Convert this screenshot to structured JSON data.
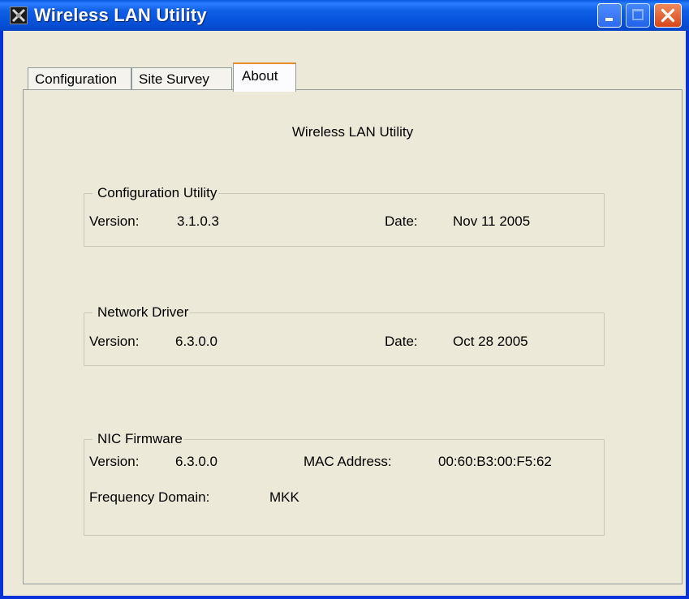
{
  "window": {
    "title": "Wireless LAN Utility",
    "controls": {
      "minimize": "minimize",
      "maximize": "maximize",
      "close": "close"
    }
  },
  "tabs": [
    {
      "label": "Configuration",
      "selected": false
    },
    {
      "label": "Site Survey",
      "selected": false
    },
    {
      "label": "About",
      "selected": true
    }
  ],
  "about": {
    "heading": "Wireless LAN Utility",
    "config_utility": {
      "group_label": "Configuration Utility",
      "version_label": "Version:",
      "version": "3.1.0.3",
      "date_label": "Date:",
      "date": "Nov 11 2005"
    },
    "network_driver": {
      "group_label": "Network Driver",
      "version_label": "Version:",
      "version": "6.3.0.0",
      "date_label": "Date:",
      "date": "Oct 28 2005"
    },
    "nic_firmware": {
      "group_label": "NIC Firmware",
      "version_label": "Version:",
      "version": "6.3.0.0",
      "mac_label": "MAC Address:",
      "mac": "00:60:B3:00:F5:62",
      "freq_label": "Frequency Domain:",
      "freq": "MKK"
    }
  },
  "colors": {
    "titlebar": "#0552d9",
    "face": "#ece9d8",
    "tab_highlight": "#e68b2c",
    "close_button": "#d7461a"
  },
  "icons": [
    "app-icon",
    "minimize-icon",
    "maximize-icon",
    "close-icon"
  ]
}
